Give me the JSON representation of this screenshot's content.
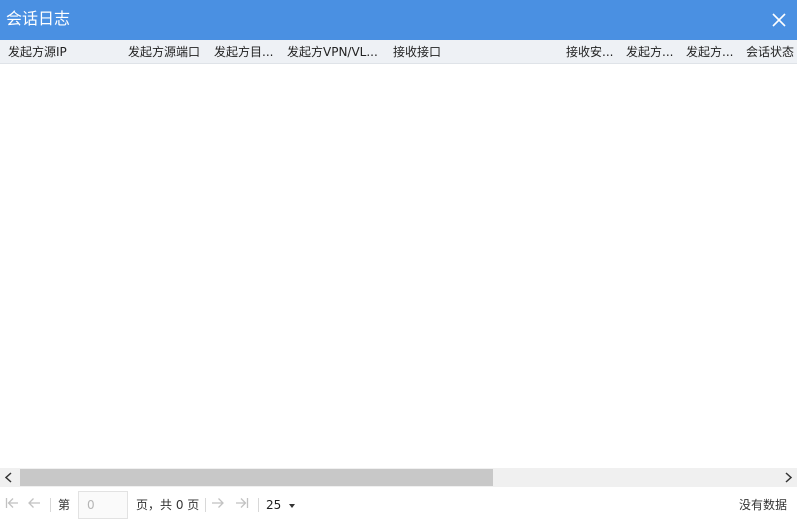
{
  "window": {
    "title": "会话日志"
  },
  "grid": {
    "columns": [
      {
        "label": "发起方源IP"
      },
      {
        "label": "发起方源端口"
      },
      {
        "label": "发起方目..."
      },
      {
        "label": "发起方VPN/VL..."
      },
      {
        "label": "接收接口"
      },
      {
        "label": "接收安..."
      },
      {
        "label": "发起方..."
      },
      {
        "label": "发起方..."
      },
      {
        "label": "会话状态"
      }
    ]
  },
  "pager": {
    "page_prefix": "第",
    "page_value": "0",
    "page_suffix": "页，共 0 页",
    "page_size": "25",
    "status": "没有数据"
  },
  "colors": {
    "title_bar": "#4a90e2",
    "header_bg": "#eef1f5",
    "scroll_thumb": "#c8c8c8"
  }
}
